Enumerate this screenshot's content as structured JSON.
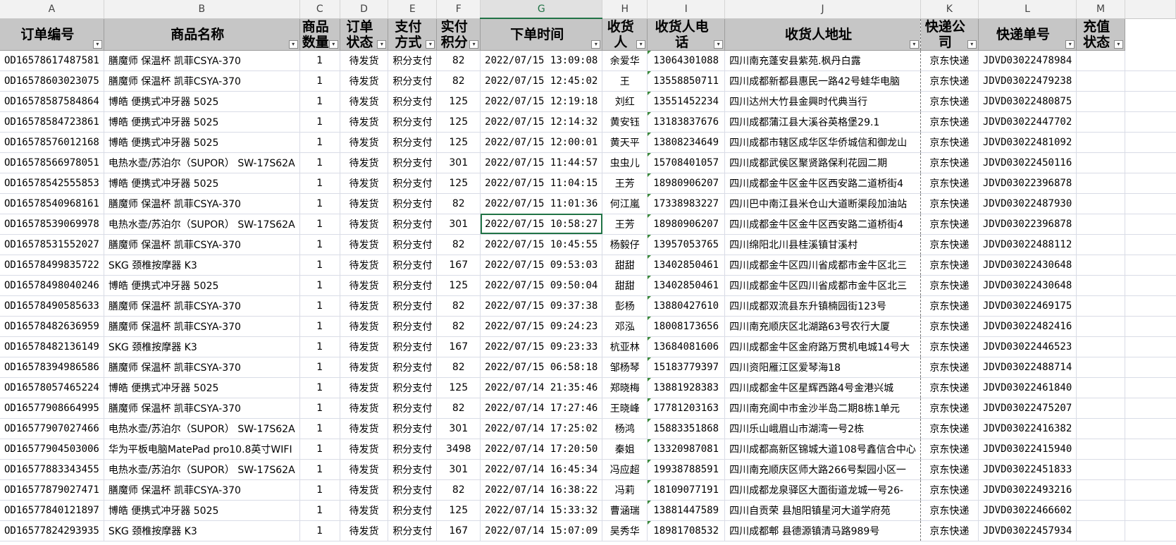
{
  "column_letters": [
    "A",
    "B",
    "C",
    "D",
    "E",
    "F",
    "G",
    "H",
    "I",
    "J",
    "K",
    "L",
    "M"
  ],
  "selected_column": "G",
  "headers": [
    "订单编号",
    "商品名称",
    "商品数量",
    "订单状态",
    "支付方式",
    "实付积分",
    "下单时间",
    "收货人",
    "收货人电话",
    "收货人地址",
    "快递公司",
    "快递单号",
    "充值状态"
  ],
  "filter_icon": "▾",
  "rows": [
    [
      "OD16578617487581",
      "膳魔师 保温杯 凯菲CSYA-370",
      "1",
      "待发货",
      "积分支付",
      "82",
      "2022/07/15 13:09:08",
      "余爱华",
      "13064301088",
      "四川南充蓬安县紫苑.枫丹白露",
      "京东快递",
      "JDVD03022478984",
      ""
    ],
    [
      "OD16578603023075",
      "膳魔师 保温杯 凯菲CSYA-370",
      "1",
      "待发货",
      "积分支付",
      "82",
      "2022/07/15 12:45:02",
      "王",
      "13558850711",
      "四川成都新都县惠民一路42号蛙华电脑",
      "京东快递",
      "JDVD03022479238",
      ""
    ],
    [
      "OD16578587584864",
      "博皓 便携式冲牙器 5025",
      "1",
      "待发货",
      "积分支付",
      "125",
      "2022/07/15 12:19:18",
      "刘红",
      "13551452234",
      "四川达州大竹县金興时代典当行",
      "京东快递",
      "JDVD03022480875",
      ""
    ],
    [
      "OD16578584723861",
      "博皓 便携式冲牙器 5025",
      "1",
      "待发货",
      "积分支付",
      "125",
      "2022/07/15 12:14:32",
      "黄安钰",
      "13183837676",
      "四川成都蒲江县大溪谷英格堡29.1",
      "京东快递",
      "JDVD03022447702",
      ""
    ],
    [
      "OD16578576012168",
      "博皓 便携式冲牙器 5025",
      "1",
      "待发货",
      "积分支付",
      "125",
      "2022/07/15 12:00:01",
      "黄天平",
      "13808234649",
      "四川成都市辖区成华区华侨城信和御龙山",
      "京东快递",
      "JDVD03022481092",
      ""
    ],
    [
      "OD16578566978051",
      "电热水壶/苏泊尔（SUPOR） SW-17S62A",
      "1",
      "待发货",
      "积分支付",
      "301",
      "2022/07/15 11:44:57",
      "虫虫儿",
      "15708401057",
      "四川成都武侯区聚贤路保利花园二期",
      "京东快递",
      "JDVD03022450116",
      ""
    ],
    [
      "OD16578542555853",
      "博皓 便携式冲牙器 5025",
      "1",
      "待发货",
      "积分支付",
      "125",
      "2022/07/15 11:04:15",
      "王芳",
      "18980906207",
      "四川成都金牛区金牛区西安路二道桥街4",
      "京东快递",
      "JDVD03022396878",
      ""
    ],
    [
      "OD16578540968161",
      "膳魔师 保温杯 凯菲CSYA-370",
      "1",
      "待发货",
      "积分支付",
      "82",
      "2022/07/15 11:01:36",
      "何江嵐",
      "17338983227",
      "四川巴中南江县米仓山大道断渠段加油站",
      "京东快递",
      "JDVD03022487930",
      ""
    ],
    [
      "OD16578539069978",
      "电热水壶/苏泊尔（SUPOR） SW-17S62A",
      "1",
      "待发货",
      "积分支付",
      "301",
      "2022/07/15 10:58:27",
      "王芳",
      "18980906207",
      "四川成都金牛区金牛区西安路二道桥街4",
      "京东快递",
      "JDVD03022396878",
      ""
    ],
    [
      "OD16578531552027",
      "膳魔师 保温杯 凯菲CSYA-370",
      "1",
      "待发货",
      "积分支付",
      "82",
      "2022/07/15 10:45:55",
      "杨毅仔",
      "13957053765",
      "四川绵阳北川县桂溪镇甘溪村",
      "京东快递",
      "JDVD03022488112",
      ""
    ],
    [
      "OD16578499835722",
      "SKG 颈椎按摩器 K3",
      "1",
      "待发货",
      "积分支付",
      "167",
      "2022/07/15 09:53:03",
      "甜甜",
      "13402850461",
      "四川成都金牛区四川省成都市金牛区北三",
      "京东快递",
      "JDVD03022430648",
      ""
    ],
    [
      "OD16578498040246",
      "博皓 便携式冲牙器 5025",
      "1",
      "待发货",
      "积分支付",
      "125",
      "2022/07/15 09:50:04",
      "甜甜",
      "13402850461",
      "四川成都金牛区四川省成都市金牛区北三",
      "京东快递",
      "JDVD03022430648",
      ""
    ],
    [
      "OD16578490585633",
      "膳魔师 保温杯 凯菲CSYA-370",
      "1",
      "待发货",
      "积分支付",
      "82",
      "2022/07/15 09:37:38",
      "彭杨",
      "13880427610",
      "四川成都双流县东升镇楠园街123号",
      "京东快递",
      "JDVD03022469175",
      ""
    ],
    [
      "OD16578482636959",
      "膳魔师 保温杯 凯菲CSYA-370",
      "1",
      "待发货",
      "积分支付",
      "82",
      "2022/07/15 09:24:23",
      "邓泓",
      "18008173656",
      "四川南充顺庆区北湖路63号农行大厦",
      "京东快递",
      "JDVD03022482416",
      ""
    ],
    [
      "OD16578482136149",
      "SKG 颈椎按摩器 K3",
      "1",
      "待发货",
      "积分支付",
      "167",
      "2022/07/15 09:23:33",
      "杭亚林",
      "13684081606",
      "四川成都金牛区金府路万贯机电城14号大",
      "京东快递",
      "JDVD03022446523",
      ""
    ],
    [
      "OD16578394986586",
      "膳魔师 保温杯 凯菲CSYA-370",
      "1",
      "待发货",
      "积分支付",
      "82",
      "2022/07/15 06:58:18",
      "邹杨琴",
      "15183779397",
      "四川资阳雁江区爱琴海18",
      "京东快递",
      "JDVD03022488714",
      ""
    ],
    [
      "OD16578057465224",
      "博皓 便携式冲牙器 5025",
      "1",
      "待发货",
      "积分支付",
      "125",
      "2022/07/14 21:35:46",
      "郑晓梅",
      "13881928383",
      "四川成都金牛区星辉西路4号金港兴城",
      "京东快递",
      "JDVD03022461840",
      ""
    ],
    [
      "OD16577908664995",
      "膳魔师 保温杯 凯菲CSYA-370",
      "1",
      "待发货",
      "积分支付",
      "82",
      "2022/07/14 17:27:46",
      "王晓峰",
      "17781203163",
      "四川南充阆中市金沙半岛二期8栋1单元",
      "京东快递",
      "JDVD03022475207",
      ""
    ],
    [
      "OD16577907027466",
      "电热水壶/苏泊尔（SUPOR） SW-17S62A",
      "1",
      "待发货",
      "积分支付",
      "301",
      "2022/07/14 17:25:02",
      "杨鸿",
      "15883351868",
      "四川乐山峨眉山市湖湾一号2栋",
      "京东快递",
      "JDVD03022416382",
      ""
    ],
    [
      "OD16577904503006",
      "华为平板电脑MatePad pro10.8英寸WIFI",
      "1",
      "待发货",
      "积分支付",
      "3498",
      "2022/07/14 17:20:50",
      "秦姐",
      "13320987081",
      "四川成都高新区锦城大道108号鑫信合中心",
      "京东快递",
      "JDVD03022415940",
      ""
    ],
    [
      "OD16577883343455",
      "电热水壶/苏泊尔（SUPOR） SW-17S62A",
      "1",
      "待发货",
      "积分支付",
      "301",
      "2022/07/14 16:45:34",
      "冯应超",
      "19938788591",
      "四川南充顺庆区师大路266号梨园小区一",
      "京东快递",
      "JDVD03022451833",
      ""
    ],
    [
      "OD16577879027471",
      "膳魔师 保温杯 凯菲CSYA-370",
      "1",
      "待发货",
      "积分支付",
      "82",
      "2022/07/14 16:38:22",
      "冯莉",
      "18109077191",
      "四川成都龙泉驿区大面街道龙城一号26-",
      "京东快递",
      "JDVD03022493216",
      ""
    ],
    [
      "OD16577840121897",
      "博皓 便携式冲牙器 5025",
      "1",
      "待发货",
      "积分支付",
      "125",
      "2022/07/14 15:33:32",
      "曹涵瑞",
      "13881447589",
      "四川自贡荣  县旭阳镇星河大道学府苑",
      "京东快递",
      "JDVD03022466602",
      ""
    ],
    [
      "OD16577824293935",
      "SKG 颈椎按摩器 K3",
      "1",
      "待发货",
      "积分支付",
      "167",
      "2022/07/14 15:07:09",
      "吴秀华",
      "18981708532",
      "四川成都郫  县德源镇清马路989号",
      "京东快递",
      "JDVD03022457934",
      ""
    ]
  ],
  "active_cell": {
    "row": 8,
    "col": 6
  }
}
